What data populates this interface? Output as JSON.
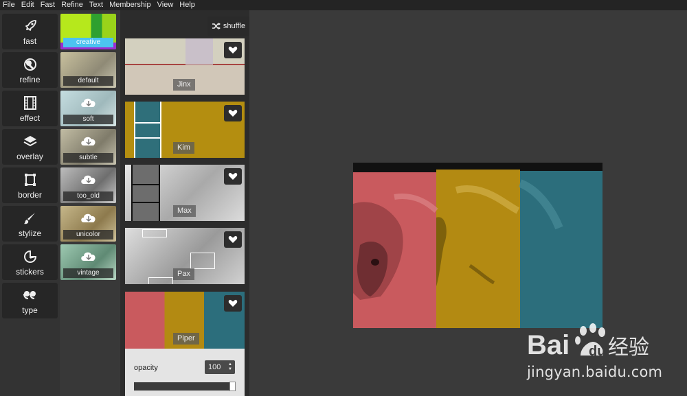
{
  "menu": [
    "File",
    "Edit",
    "Fast",
    "Refine",
    "Text",
    "Membership",
    "View",
    "Help"
  ],
  "tools": [
    {
      "label": "fast",
      "icon": "rocket-icon"
    },
    {
      "label": "refine",
      "icon": "refine-icon"
    },
    {
      "label": "effect",
      "icon": "film-icon"
    },
    {
      "label": "overlay",
      "icon": "layers-icon"
    },
    {
      "label": "border",
      "icon": "border-icon"
    },
    {
      "label": "stylize",
      "icon": "brush-icon"
    },
    {
      "label": "stickers",
      "icon": "sticker-icon"
    },
    {
      "label": "type",
      "icon": "quote-icon"
    }
  ],
  "categories": [
    {
      "label": "creative",
      "active": true
    },
    {
      "label": "default",
      "active": false
    },
    {
      "label": "soft",
      "active": false
    },
    {
      "label": "subtle",
      "active": false
    },
    {
      "label": "too_old",
      "active": false
    },
    {
      "label": "unicolor",
      "active": false
    },
    {
      "label": "vintage",
      "active": false
    }
  ],
  "shuffle_label": "shuffle",
  "filters": [
    {
      "name": "Jinx"
    },
    {
      "name": "Kim"
    },
    {
      "name": "Max"
    },
    {
      "name": "Pax"
    },
    {
      "name": "Piper"
    }
  ],
  "opacity": {
    "label": "opacity",
    "value": "100",
    "fraction": 1.0
  },
  "watermark": {
    "text": "jingyan.baidu.com"
  },
  "colors": {
    "accent": "#4cc3f0",
    "pink": "#c95a5e",
    "mustard": "#b38a12",
    "teal": "#2c6e7c"
  }
}
